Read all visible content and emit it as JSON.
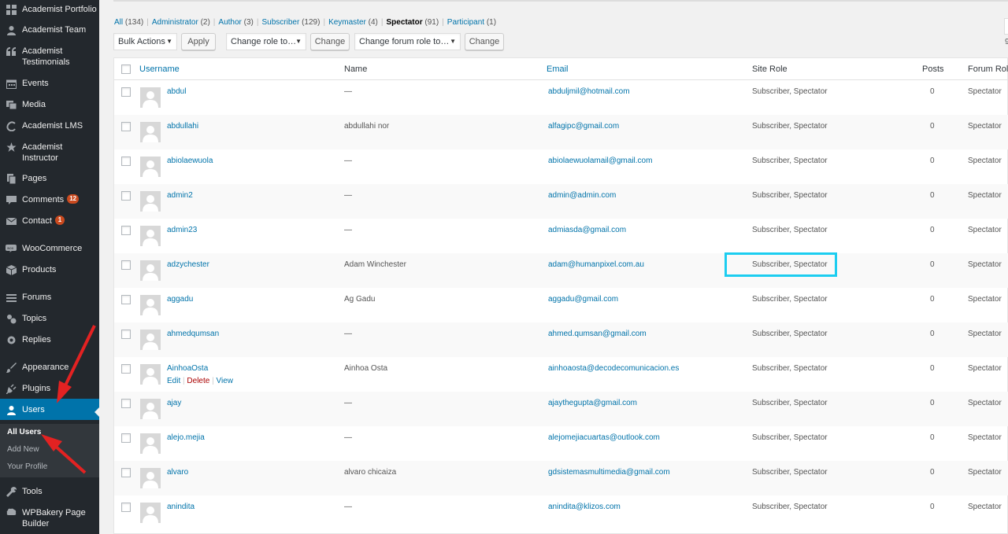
{
  "colors": {
    "sidebar_bg": "#23282d",
    "accent": "#0073aa",
    "badge": "#ca4a1f",
    "highlight": "#1ccdf0",
    "annotation_arrow": "#e32222"
  },
  "sidebar": {
    "items": [
      {
        "label": "Academist Portfolio",
        "icon": "grid-icon"
      },
      {
        "label": "Academist Team",
        "icon": "person-icon"
      },
      {
        "label": "Academist Testimonials",
        "icon": "quote-icon"
      },
      {
        "label": "Events",
        "icon": "calendar-icon"
      },
      {
        "label": "Media",
        "icon": "media-icon"
      },
      {
        "label": "Academist LMS",
        "icon": "lms-icon"
      },
      {
        "label": "Academist Instructor",
        "icon": "star-person-icon"
      },
      {
        "label": "Pages",
        "icon": "page-icon"
      },
      {
        "label": "Comments",
        "icon": "comment-icon",
        "badge": "12"
      },
      {
        "label": "Contact",
        "icon": "mail-icon",
        "badge": "1"
      },
      {
        "label": "WooCommerce",
        "icon": "woo-icon"
      },
      {
        "label": "Products",
        "icon": "box-icon"
      },
      {
        "label": "Forums",
        "icon": "forum-icon"
      },
      {
        "label": "Topics",
        "icon": "topic-icon"
      },
      {
        "label": "Replies",
        "icon": "reply-icon"
      },
      {
        "label": "Appearance",
        "icon": "brush-icon"
      },
      {
        "label": "Plugins",
        "icon": "plug-icon"
      },
      {
        "label": "Users",
        "icon": "user-icon",
        "current": true
      },
      {
        "label": "Tools",
        "icon": "wrench-icon"
      },
      {
        "label": "WPBakery Page Builder",
        "icon": "bakery-icon"
      }
    ],
    "submenu": [
      "All Users",
      "Add New",
      "Your Profile"
    ]
  },
  "filters": {
    "all": "All",
    "all_count": "(134)",
    "administrator": "Administrator",
    "administrator_count": "(2)",
    "author": "Author",
    "author_count": "(3)",
    "subscriber": "Subscriber",
    "subscriber_count": "(129)",
    "keymaster": "Keymaster",
    "keymaster_count": "(4)",
    "spectator": "Spectator",
    "spectator_count": "(91)",
    "participant": "Participant",
    "participant_count": "(1)"
  },
  "toolbar": {
    "bulk_actions": "Bulk Actions",
    "apply": "Apply",
    "change_role": "Change role to…",
    "change": "Change",
    "change_forum_role": "Change forum role to…",
    "change2": "Change",
    "right_stub": "9"
  },
  "table": {
    "headers": {
      "username": "Username",
      "name": "Name",
      "email": "Email",
      "site_role": "Site Role",
      "posts": "Posts",
      "forum_role": "Forum Role"
    },
    "row_actions": {
      "edit": "Edit",
      "delete": "Delete",
      "view": "View",
      "sep": "|"
    },
    "rows": [
      {
        "username": "abdul",
        "name": "—",
        "email": "abduljmil@hotmail.com",
        "role": "Subscriber, Spectator",
        "posts": "0",
        "forum_role": "Spectator"
      },
      {
        "username": "abdullahi",
        "name": "abdullahi nor",
        "email": "alfagipc@gmail.com",
        "role": "Subscriber, Spectator",
        "posts": "0",
        "forum_role": "Spectator"
      },
      {
        "username": "abiolaewuola",
        "name": "—",
        "email": "abiolaewuolamail@gmail.com",
        "role": "Subscriber, Spectator",
        "posts": "0",
        "forum_role": "Spectator"
      },
      {
        "username": "admin2",
        "name": "—",
        "email": "admin@admin.com",
        "role": "Subscriber, Spectator",
        "posts": "0",
        "forum_role": "Spectator"
      },
      {
        "username": "admin23",
        "name": "—",
        "email": "admiasda@gmail.com",
        "role": "Subscriber, Spectator",
        "posts": "0",
        "forum_role": "Spectator"
      },
      {
        "username": "adzychester",
        "name": "Adam Winchester",
        "email": "adam@humanpixel.com.au",
        "role": "Subscriber, Spectator",
        "posts": "0",
        "forum_role": "Spectator"
      },
      {
        "username": "aggadu",
        "name": "Ag Gadu",
        "email": "aggadu@gmail.com",
        "role": "Subscriber, Spectator",
        "posts": "0",
        "forum_role": "Spectator"
      },
      {
        "username": "ahmedqumsan",
        "name": "—",
        "email": "ahmed.qumsan@gmail.com",
        "role": "Subscriber, Spectator",
        "posts": "0",
        "forum_role": "Spectator"
      },
      {
        "username": "AinhoaOsta",
        "name": "Ainhoa Osta",
        "email": "ainhoaosta@decodecomunicacion.es",
        "role": "Subscriber, Spectator",
        "posts": "0",
        "forum_role": "Spectator"
      },
      {
        "username": "ajay",
        "name": "—",
        "email": "ajaythegupta@gmail.com",
        "role": "Subscriber, Spectator",
        "posts": "0",
        "forum_role": "Spectator"
      },
      {
        "username": "alejo.mejia",
        "name": "—",
        "email": "alejomejiacuartas@outlook.com",
        "role": "Subscriber, Spectator",
        "posts": "0",
        "forum_role": "Spectator"
      },
      {
        "username": "alvaro",
        "name": "alvaro chicaiza",
        "email": "gdsistemasmultimedia@gmail.com",
        "role": "Subscriber, Spectator",
        "posts": "0",
        "forum_role": "Spectator"
      },
      {
        "username": "anindita",
        "name": "—",
        "email": "anindita@klizos.com",
        "role": "Subscriber, Spectator",
        "posts": "0",
        "forum_role": "Spectator"
      }
    ]
  }
}
